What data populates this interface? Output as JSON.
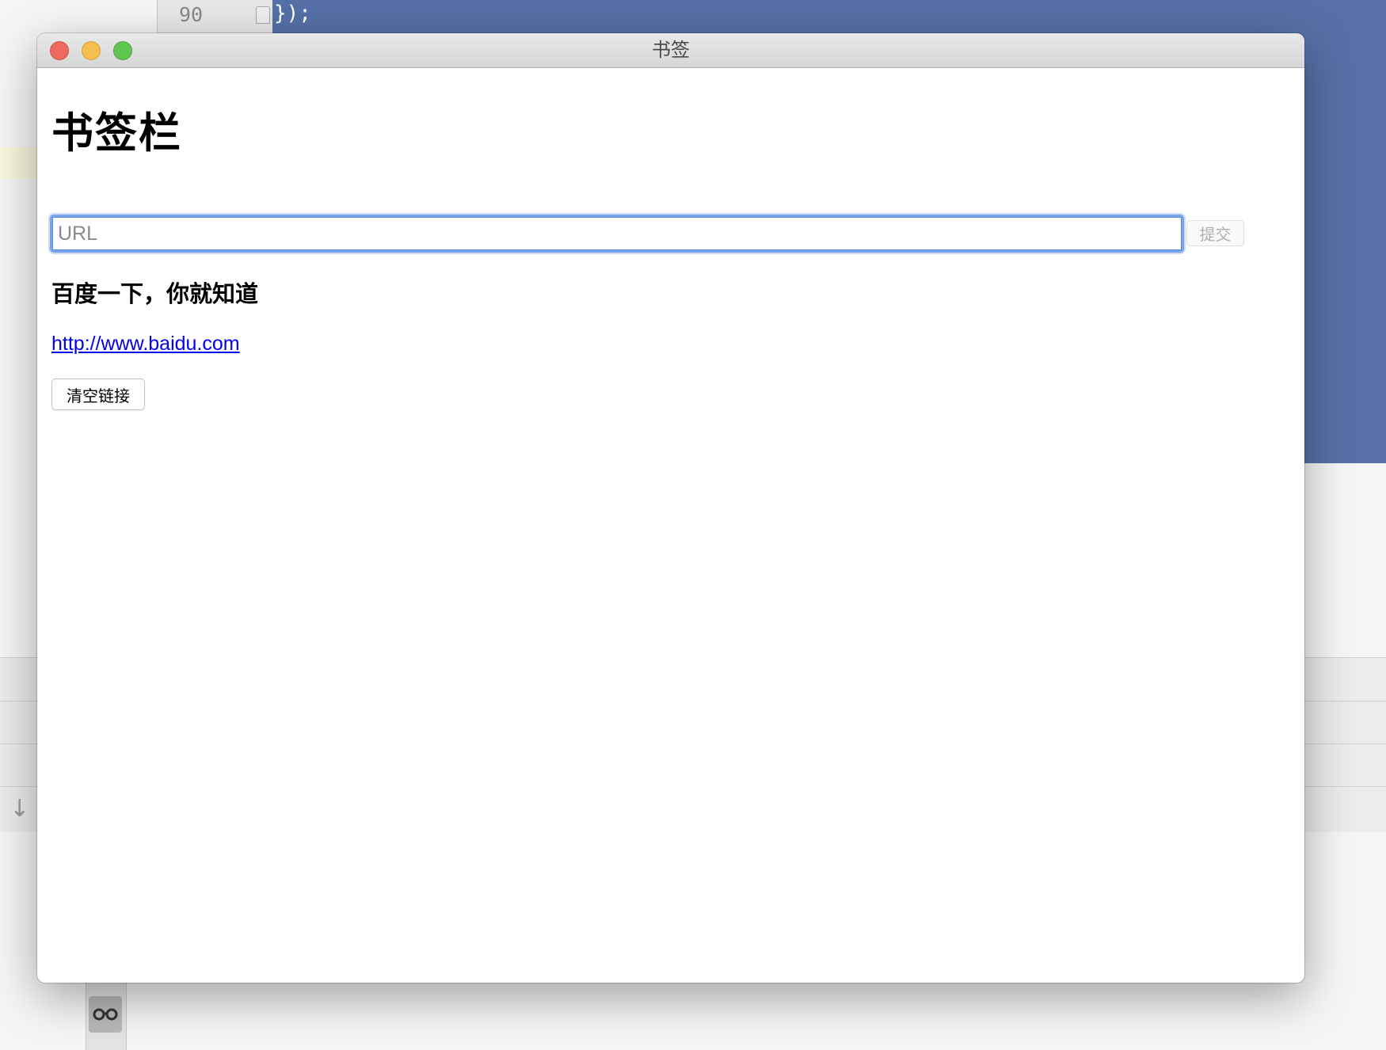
{
  "background_editor": {
    "line_number": "90",
    "code_line": "});"
  },
  "window": {
    "title": "书签"
  },
  "page": {
    "heading": "书签栏",
    "url_input": {
      "value": "",
      "placeholder": "URL"
    },
    "submit_label": "提交",
    "bookmarks": [
      {
        "title": "百度一下，你就知道",
        "url": "http://www.baidu.com"
      }
    ],
    "clear_label": "清空链接"
  },
  "colors": {
    "selection": "#5671a7",
    "focus_ring": "#7aa3ed",
    "link": "#0000ee",
    "close": "#ed6a5e",
    "minimize": "#f5bf4f",
    "zoom": "#61c554"
  },
  "icons": {
    "reader": "glasses-icon",
    "down": "arrow-down-icon"
  }
}
